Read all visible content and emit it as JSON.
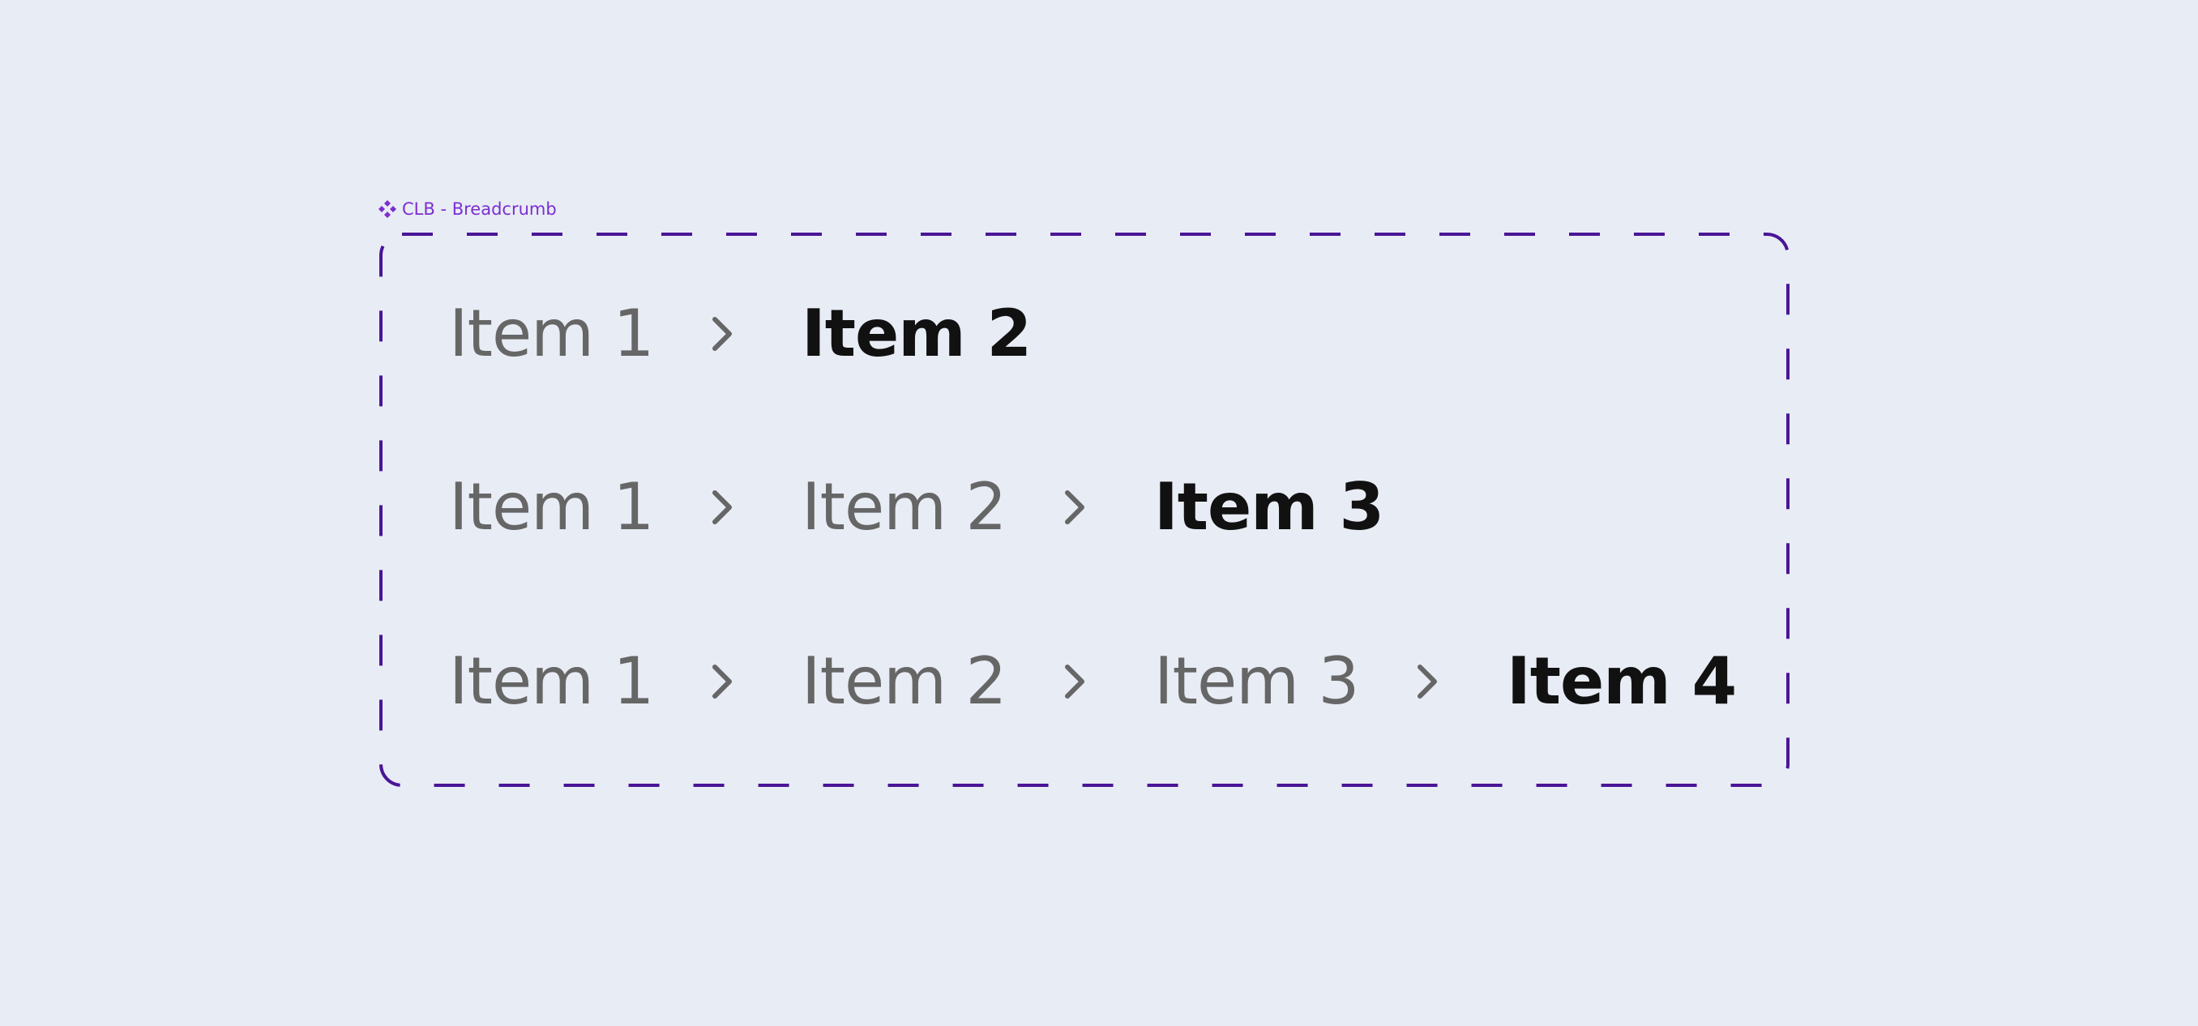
{
  "component": {
    "label": "CLB - Breadcrumb",
    "icon": "component-diamond-icon",
    "accent_color": "#7b2fd1",
    "border_color": "#4a1596"
  },
  "colors": {
    "background": "#e8ecf5",
    "link_text": "#666666",
    "current_text": "#111111",
    "separator": "#666666"
  },
  "separator_icon": "chevron-right-icon",
  "rows": [
    {
      "items": [
        "Item 1"
      ],
      "current": "Item 2"
    },
    {
      "items": [
        "Item 1",
        "Item 2"
      ],
      "current": "Item 3"
    },
    {
      "items": [
        "Item 1",
        "Item 2",
        "Item 3"
      ],
      "current": "Item 4"
    }
  ]
}
